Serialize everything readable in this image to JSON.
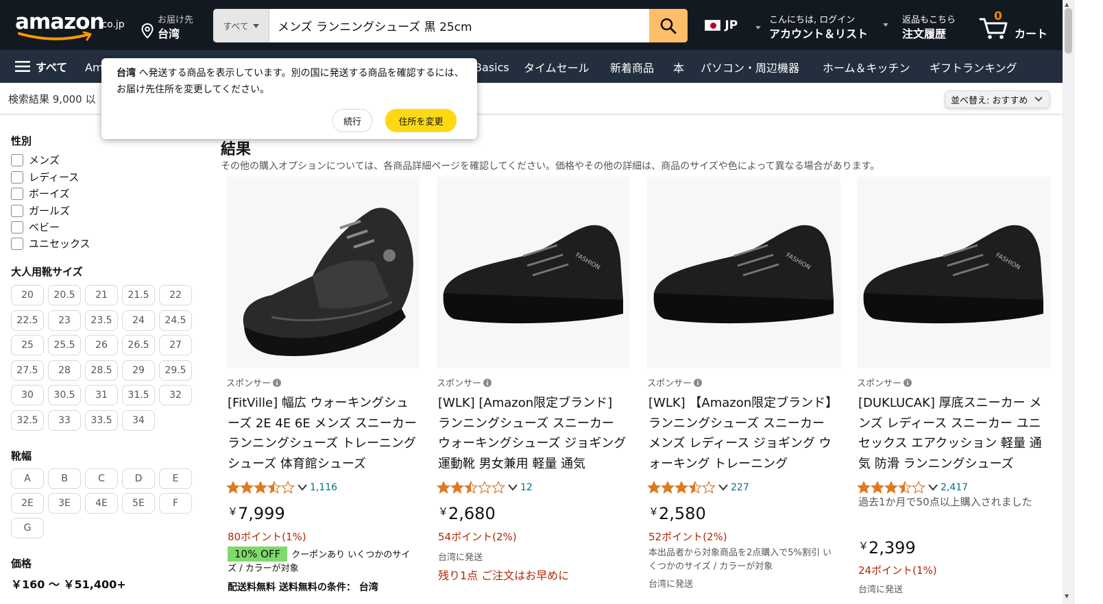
{
  "header": {
    "logo_text": "amazon",
    "logo_tld": ".co.jp",
    "deliver_to_small": "お届け先",
    "deliver_to_big": "台湾",
    "search_category": "すべて",
    "search_value": "メンズ ランニングシューズ 黒 25cm",
    "lang_code": "JP",
    "account_small": "こんにちは, ログイン",
    "account_big": "アカウント＆リスト",
    "orders_small": "返品もこちら",
    "orders_big": "注文履歴",
    "cart_count": "0",
    "cart_label": "カート"
  },
  "nav": {
    "all_label": "すべて",
    "partial_left": "Am",
    "partial_right": "Basics",
    "links": [
      "タイムセール",
      "新着商品",
      "本",
      "パソコン・周辺機器",
      "ホーム＆キッチン",
      "ギフトランキング"
    ]
  },
  "subbar": {
    "result_count": "検索結果 9,000 以",
    "sort_label": "並べ替え:",
    "sort_value": "おすすめ"
  },
  "popup": {
    "location": "台湾",
    "message": " へ発送する商品を表示しています。別の国に発送する商品を確認するには、お届け先住所を変更してください。",
    "continue_label": "続行",
    "change_label": "住所を変更"
  },
  "sidebar": {
    "gender_title": "性別",
    "gender_options": [
      "メンズ",
      "レディース",
      "ボーイズ",
      "ガールズ",
      "ベビー",
      "ユニセックス"
    ],
    "size_title": "大人用靴サイズ",
    "sizes": [
      "20",
      "20.5",
      "21",
      "21.5",
      "22",
      "22.5",
      "23",
      "23.5",
      "24",
      "24.5",
      "25",
      "25.5",
      "26",
      "26.5",
      "27",
      "27.5",
      "28",
      "28.5",
      "29",
      "29.5",
      "30",
      "30.5",
      "31",
      "31.5",
      "32",
      "32.5",
      "33",
      "33.5",
      "34"
    ],
    "width_title": "靴幅",
    "widths": [
      "A",
      "B",
      "C",
      "D",
      "E",
      "2E",
      "3E",
      "4E",
      "5E",
      "F",
      "G"
    ],
    "price_title": "価格",
    "price_range": "￥160 ～ ￥51,400+"
  },
  "main": {
    "heading": "結果",
    "subheading": "その他の購入オプションについては、各商品詳細ページを確認してください。価格やその他の詳細は、商品のサイズや色によって異なる場合があります。"
  },
  "products": [
    {
      "sponsored": "スポンサー",
      "title": "[FitVille] 幅広 ウォーキングシューズ 2E 4E 6E メンズ スニーカー ランニングシューズ トレーニングシューズ 体育館シューズ",
      "rating": 3.5,
      "review_count": "1,116",
      "price": "7,999",
      "points": "80ポイント(1%)",
      "coupon": "10% OFF",
      "coupon_note": "クーポンあり いくつかのサイズ / カラーが対象",
      "shipping": "配送料無料 送料無料の条件： 台湾"
    },
    {
      "sponsored": "スポンサー",
      "title": "[WLK] [Amazon限定ブランド] ランニングシューズ スニーカー ウォーキングシューズ ジョギング 運動靴 男女兼用 軽量 通気",
      "rating": 2.5,
      "review_count": "12",
      "price": "2,680",
      "points": "54ポイント(2%)",
      "ship_to": "台湾に発送",
      "stock": "残り1点 ご注文はお早めに"
    },
    {
      "sponsored": "スポンサー",
      "title": "[WLK] 【Amazon限定ブランド】ランニングシューズ スニーカー メンズ レディース ジョギング ウォーキング トレーニング",
      "rating": 3.5,
      "review_count": "227",
      "price": "2,580",
      "points": "52ポイント(2%)",
      "promo_note": "本出品者から対象商品を2点購入で5%割引 いくつかのサイズ / カラーが対象",
      "ship_to": "台湾に発送"
    },
    {
      "sponsored": "スポンサー",
      "title": "[DUKLUCAK] 厚底スニーカー メンズ レディース スニーカー ユニセックス エアクッション 軽量 通気 防滑 ランニングシューズ",
      "rating": 3.5,
      "review_count": "2,417",
      "bought_note": "過去1か月で50点以上購入されました",
      "price": "2,399",
      "points": "24ポイント(1%)",
      "ship_to": "台湾に発送"
    }
  ],
  "colors": {
    "header_bg": "#131921",
    "nav_bg": "#232f3e",
    "search_btn": "#febd69",
    "accent_orange": "#f08804",
    "primary_yellow": "#ffd814",
    "price_red": "#b12704",
    "link_teal": "#007185",
    "star": "#de7921",
    "coupon_green": "#7fda69"
  },
  "icons": {
    "location": "location-pin-icon",
    "search": "search-icon",
    "cart": "cart-icon",
    "menu": "hamburger-menu-icon",
    "info": "info-icon",
    "chevron": "chevron-down-icon"
  }
}
